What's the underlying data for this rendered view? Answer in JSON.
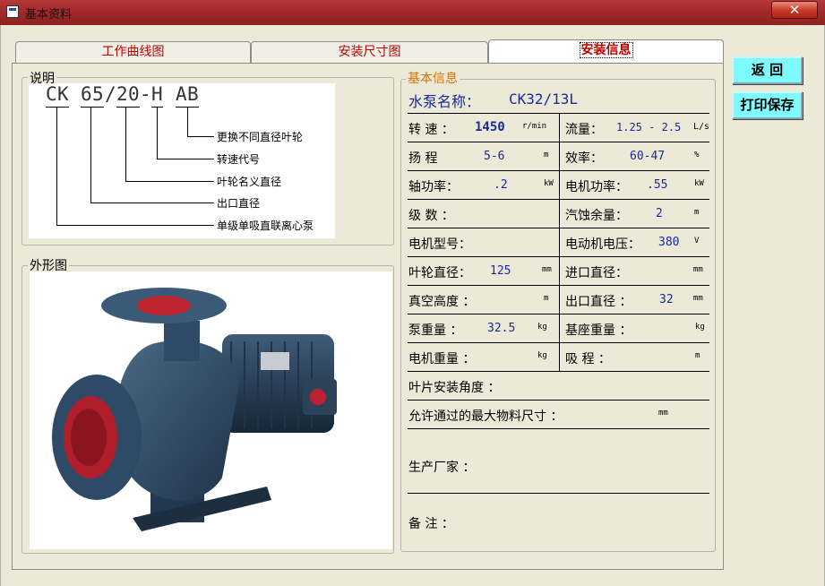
{
  "window": {
    "title": "基本资料",
    "close_glyph": "✕"
  },
  "tabs": [
    {
      "label": "工作曲线图"
    },
    {
      "label": "安装尺寸图"
    },
    {
      "label": "安装信息"
    }
  ],
  "explanation": {
    "group_label": "说明",
    "code_chars": [
      "C",
      "K",
      "6",
      "5",
      "/",
      "2",
      "0",
      "-",
      "H",
      "A",
      "B"
    ],
    "legend": [
      "更换不同直径叶轮",
      "转速代号",
      "叶轮名义直径",
      "出口直径",
      "单级单吸直联离心泵"
    ]
  },
  "appearance": {
    "group_label": "外形图"
  },
  "basic_info": {
    "group_label": "基本信息",
    "pump_name_label": "水泵名称：",
    "pump_name_value": "CK32/13L",
    "rows": {
      "speed": {
        "label": "转  速 ：",
        "value": "1450",
        "unit": "r/min"
      },
      "flow": {
        "label": "流量：",
        "value": "1.25 - 2.5",
        "unit": "L/s"
      },
      "head": {
        "label": "扬  程",
        "value": "5-6",
        "unit": "m"
      },
      "efficiency": {
        "label": "效率：",
        "value": "60-47",
        "unit": "%"
      },
      "shaft_power": {
        "label": "轴功率：",
        "value": ".2",
        "unit": "kW"
      },
      "motor_power": {
        "label": "电机功率：",
        "value": ".55",
        "unit": "kW"
      },
      "stages": {
        "label": "级  数 ："
      },
      "npsh": {
        "label": "汽蚀余量：",
        "value": "2",
        "unit": "m"
      },
      "motor_model": {
        "label": "电机型号："
      },
      "motor_voltage": {
        "label": "电动机电压：",
        "value": "380",
        "unit": "V"
      },
      "impeller_dia": {
        "label": "叶轮直径：",
        "value": "125",
        "unit": "mm"
      },
      "inlet_dia": {
        "label": "进口直径：",
        "unit": "mm"
      },
      "vacuum_height": {
        "label": "真空高度 ：",
        "unit": "m"
      },
      "outlet_dia": {
        "label": "出口直径 ：",
        "value": "32",
        "unit": "mm"
      },
      "pump_weight": {
        "label": "泵重量 ：",
        "value": "32.5",
        "unit": "kg"
      },
      "base_weight": {
        "label": "基座重量 ：",
        "unit": "kg"
      },
      "motor_weight": {
        "label": "电机重量 ：",
        "unit": "kg"
      },
      "suction_lift": {
        "label": "吸  程 ：",
        "unit": "m"
      },
      "blade_angle": {
        "label": "叶片安装角度 ："
      },
      "max_particle": {
        "label": "允许通过的最大物料尺寸 ：",
        "unit": "mm"
      },
      "manufacturer": {
        "label": "生产厂家 ："
      },
      "remarks": {
        "label": "备  注 ："
      }
    }
  },
  "buttons": {
    "back": "返  回",
    "print_save": "打印保存"
  },
  "colors": {
    "titlebar": "#a32b2b",
    "tab_text": "#c00000",
    "button_bg": "#7dfbff",
    "value_text": "#1a2a9a",
    "group_label_orange": "#e07000"
  }
}
